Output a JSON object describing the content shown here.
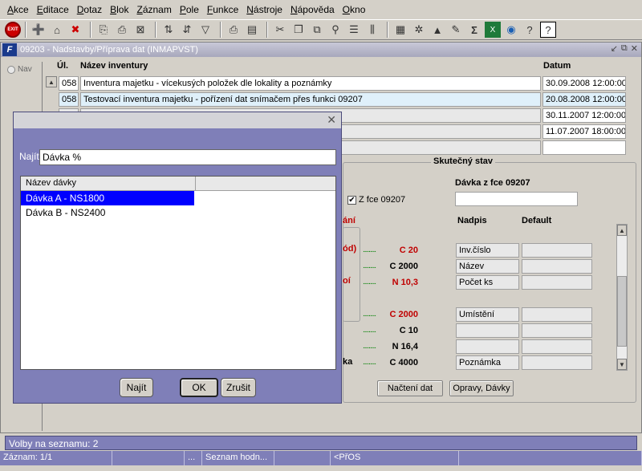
{
  "menu": [
    {
      "u": "A",
      "rest": "kce"
    },
    {
      "u": "E",
      "rest": "ditace"
    },
    {
      "u": "D",
      "rest": "otaz"
    },
    {
      "u": "B",
      "rest": "lok"
    },
    {
      "u": "Z",
      "rest": "áznam"
    },
    {
      "u": "P",
      "rest": "ole"
    },
    {
      "u": "F",
      "rest": "unkce"
    },
    {
      "u": "N",
      "rest": "ástroje"
    },
    {
      "u": "N",
      "rest": "ápověda"
    },
    {
      "u": "O",
      "rest": "kno"
    }
  ],
  "toolbar": {
    "exit_label": "EXIT"
  },
  "window": {
    "title": "09203 - Nadstavby/Příprava dat (INMAPVST)",
    "controls": [
      "↙",
      "⧉",
      "✕"
    ]
  },
  "nav": {
    "label": "Nav"
  },
  "table": {
    "headers": {
      "ul": "Úl.",
      "name": "Název inventury",
      "date": "Datum"
    },
    "rows": [
      {
        "ul": "058",
        "name": "Inventura majetku - vícekusých položek dle lokality a poznámky",
        "date": "30.09.2008 12:00:00"
      },
      {
        "ul": "058",
        "name": "Testovací inventura majetku - pořízení dat snímačem přes funkci 09207",
        "date": "20.08.2008 12:00:00"
      },
      {
        "ul": "",
        "name": "",
        "date": "30.11.2007 12:00:00"
      },
      {
        "ul": "",
        "name": "",
        "date": "11.07.2007 18:00:00"
      },
      {
        "ul": "",
        "name": "",
        "date": ""
      }
    ]
  },
  "form": {
    "section_title": "Skutečný stav",
    "batch_label": "Dávka z fce 09207",
    "checkbox_label": "Z fce 09207",
    "checkbox_checked": true,
    "col_nadpis": "Nadpis",
    "col_default": "Default",
    "left_partial": [
      {
        "text": "ání",
        "red": true
      },
      {
        "text": "ód)",
        "red": true
      },
      {
        "text": "",
        "red": false
      },
      {
        "text": "oí",
        "red": true
      },
      {
        "text": "",
        "red": false
      },
      {
        "text": "",
        "red": false
      },
      {
        "text": "",
        "red": false
      },
      {
        "text": "",
        "red": false
      },
      {
        "text": "ka",
        "red": false
      }
    ],
    "rows": [
      {
        "type": "C 20",
        "red": true,
        "nadpis": "Inv.číslo"
      },
      {
        "type": "C 2000",
        "red": false,
        "nadpis": "Název"
      },
      {
        "type": "N 10,3",
        "red": true,
        "nadpis": "Počet ks"
      },
      {
        "type": "C 2000",
        "red": true,
        "nadpis": "Umístění"
      },
      {
        "type": "C 10",
        "red": false,
        "nadpis": ""
      },
      {
        "type": "N 16,4",
        "red": false,
        "nadpis": ""
      },
      {
        "type": "C 4000",
        "red": false,
        "nadpis": "Poznámka"
      }
    ],
    "btn_load": "Načtení dat",
    "btn_fix": "Opravy, Dávky"
  },
  "dialog": {
    "find_label": "Najít",
    "find_value": "Dávka %",
    "list_header": "Název dávky",
    "items": [
      "Dávka A - NS1800",
      "Dávka B - NS2400"
    ],
    "selected_index": 0,
    "btn_find": "Najít",
    "btn_ok": "OK",
    "btn_cancel": "Zrušit"
  },
  "status": {
    "line1": "Volby na seznamu: 2",
    "cells": [
      "Záznam: 1/1",
      "",
      "...",
      "Seznam hodn...",
      "",
      "<PřOS",
      ""
    ]
  }
}
